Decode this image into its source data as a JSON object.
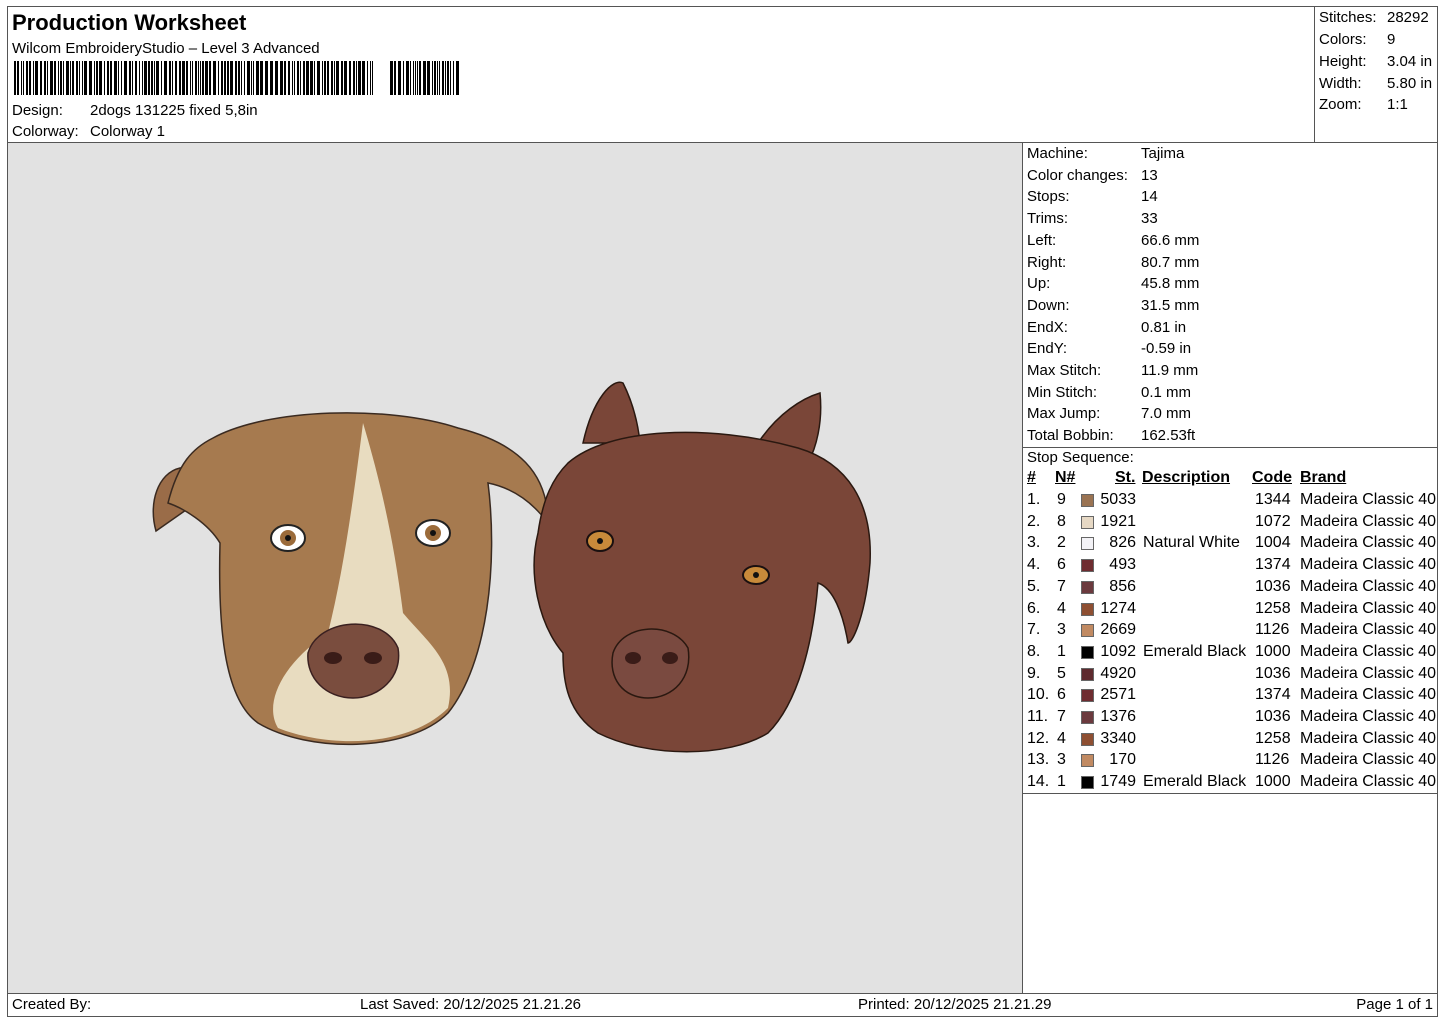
{
  "header": {
    "title": "Production Worksheet",
    "software": "Wilcom EmbroideryStudio – Level 3 Advanced",
    "design_label": "Design:",
    "design": "2dogs 131225 fixed 5,8in",
    "colorway_label": "Colorway:",
    "colorway": "Colorway 1"
  },
  "stats": [
    {
      "label": "Stitches:",
      "value": "28292"
    },
    {
      "label": "Colors:",
      "value": "9"
    },
    {
      "label": "Height:",
      "value": "3.04 in"
    },
    {
      "label": "Width:",
      "value": "5.80 in"
    },
    {
      "label": "Zoom:",
      "value": "1:1"
    }
  ],
  "machine_info": [
    {
      "label": "Machine:",
      "value": "Tajima"
    },
    {
      "label": "Color changes:",
      "value": "13"
    },
    {
      "label": "Stops:",
      "value": "14"
    },
    {
      "label": "Trims:",
      "value": "33"
    },
    {
      "label": "Left:",
      "value": "66.6 mm"
    },
    {
      "label": "Right:",
      "value": "80.7 mm"
    },
    {
      "label": "Up:",
      "value": "45.8 mm"
    },
    {
      "label": "Down:",
      "value": "31.5 mm"
    },
    {
      "label": "EndX:",
      "value": "0.81 in"
    },
    {
      "label": "EndY:",
      "value": "-0.59 in"
    },
    {
      "label": "Max Stitch:",
      "value": "11.9 mm"
    },
    {
      "label": "Min Stitch:",
      "value": "0.1 mm"
    },
    {
      "label": "Max Jump:",
      "value": "7.0 mm"
    },
    {
      "label": "Total Bobbin:",
      "value": "162.53ft"
    }
  ],
  "stop_sequence": {
    "title": "Stop Sequence:",
    "headers": [
      "#",
      "N#",
      "St.",
      "Description",
      "Code",
      "Brand"
    ],
    "rows": [
      {
        "idx": "1.",
        "n": "9",
        "color": "#9a7352",
        "st": "5033",
        "desc": "",
        "code": "1344",
        "brand": "Madeira Classic 40"
      },
      {
        "idx": "2.",
        "n": "8",
        "color": "#e6d8c4",
        "st": "1921",
        "desc": "",
        "code": "1072",
        "brand": "Madeira Classic 40"
      },
      {
        "idx": "3.",
        "n": "2",
        "color": "#f3f2f6",
        "st": "826",
        "desc": "Natural White",
        "code": "1004",
        "brand": "Madeira Classic 40"
      },
      {
        "idx": "4.",
        "n": "6",
        "color": "#6e2c30",
        "st": "493",
        "desc": "",
        "code": "1374",
        "brand": "Madeira Classic 40"
      },
      {
        "idx": "5.",
        "n": "7",
        "color": "#6b3a3e",
        "st": "856",
        "desc": "",
        "code": "1036",
        "brand": "Madeira Classic 40"
      },
      {
        "idx": "6.",
        "n": "4",
        "color": "#8e4f32",
        "st": "1274",
        "desc": "",
        "code": "1258",
        "brand": "Madeira Classic 40"
      },
      {
        "idx": "7.",
        "n": "3",
        "color": "#c18a62",
        "st": "2669",
        "desc": "",
        "code": "1126",
        "brand": "Madeira Classic 40"
      },
      {
        "idx": "8.",
        "n": "1",
        "color": "#000000",
        "st": "1092",
        "desc": "Emerald Black",
        "code": "1000",
        "brand": "Madeira Classic 40"
      },
      {
        "idx": "9.",
        "n": "5",
        "color": "#5e2a2e",
        "st": "4920",
        "desc": "",
        "code": "1036",
        "brand": "Madeira Classic 40"
      },
      {
        "idx": "10.",
        "n": "6",
        "color": "#6e2c30",
        "st": "2571",
        "desc": "",
        "code": "1374",
        "brand": "Madeira Classic 40"
      },
      {
        "idx": "11.",
        "n": "7",
        "color": "#6b3a3e",
        "st": "1376",
        "desc": "",
        "code": "1036",
        "brand": "Madeira Classic 40"
      },
      {
        "idx": "12.",
        "n": "4",
        "color": "#8e4f32",
        "st": "3340",
        "desc": "",
        "code": "1258",
        "brand": "Madeira Classic 40"
      },
      {
        "idx": "13.",
        "n": "3",
        "color": "#c18a62",
        "st": "170",
        "desc": "",
        "code": "1126",
        "brand": "Madeira Classic 40"
      },
      {
        "idx": "14.",
        "n": "1",
        "color": "#000000",
        "st": "1749",
        "desc": "Emerald Black",
        "code": "1000",
        "brand": "Madeira Classic 40"
      }
    ]
  },
  "footer": {
    "created_by": "Created By:",
    "last_saved": "Last Saved: 20/12/2025 21.21.26",
    "printed": "Printed: 20/12/2025 21.21.29",
    "page": "Page 1 of 1"
  },
  "preview": {
    "background": "#e2e2e2",
    "dog_left_colors": [
      "#a67a4f",
      "#e8dcc0",
      "#7a4d3e"
    ],
    "dog_right_colors": [
      "#7a4638",
      "#5e3028"
    ]
  }
}
